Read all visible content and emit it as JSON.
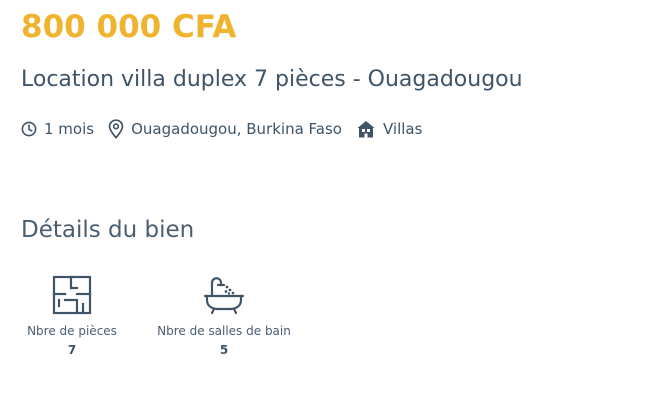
{
  "listing": {
    "price": "800 000 CFA",
    "title": "Location villa duplex 7 pièces - Ouagadougou",
    "meta": {
      "duration": "1 mois",
      "location": "Ouagadougou, Burkina Faso",
      "category": "Villas"
    }
  },
  "details": {
    "heading": "Détails du bien",
    "items": [
      {
        "icon": "floor-plan-icon",
        "label": "Nbre de pièces",
        "value": "7"
      },
      {
        "icon": "bathtub-icon",
        "label": "Nbre de salles de bain",
        "value": "5"
      }
    ]
  },
  "colors": {
    "price": "#f0b32e",
    "text": "#3f5468"
  }
}
